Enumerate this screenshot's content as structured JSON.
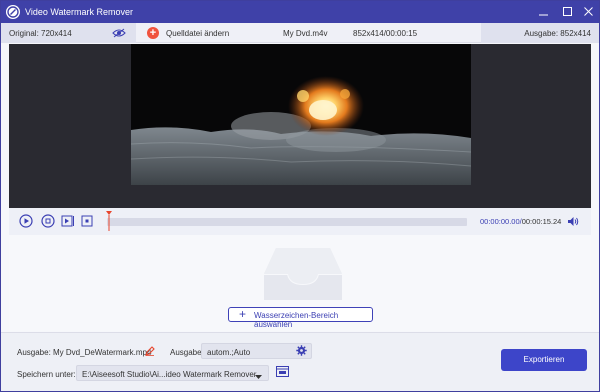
{
  "window": {
    "title": "Video Watermark Remover"
  },
  "info_bar": {
    "original_label": "Original: 720x414",
    "change_source_label": "Quelldatei ändern",
    "file_name": "My Dvd.m4v",
    "file_info": "852x414/00:00:15",
    "output_label": "Ausgabe: 852x414"
  },
  "player": {
    "current_time": "00:00:00.00",
    "separator": "/",
    "total_time": "00:00:15.24",
    "progress": 0.0
  },
  "watermark": {
    "add_area_label": "Wasserzeichen-Bereich auswählen"
  },
  "output": {
    "file_label": "Ausgabe:",
    "file_name": "My Dvd_DeWatermark.mp4",
    "format_label": "Ausgabe:",
    "format_value": "autom.;Auto",
    "save_label": "Speichern unter:",
    "save_path": "E:\\Aiseesoft Studio\\Ai...ideo Watermark Remover",
    "export_label": "Exportieren"
  },
  "colors": {
    "titlebar": "#3f41a8",
    "accent": "#3b3fb3",
    "export_button": "#3d45c9",
    "add_icon": "#f0533e",
    "playhead": "#e8452c"
  },
  "icons": [
    "app-logo-icon",
    "minimize-icon",
    "maximize-icon",
    "close-icon",
    "eye-icon",
    "add-icon",
    "play-icon",
    "stop-icon",
    "next-frame-icon",
    "clip-icon",
    "playhead-marker-icon",
    "volume-icon",
    "tray-icon",
    "plus-icon",
    "edit-icon",
    "gear-icon",
    "dropdown-arrow-icon",
    "folder-icon"
  ]
}
